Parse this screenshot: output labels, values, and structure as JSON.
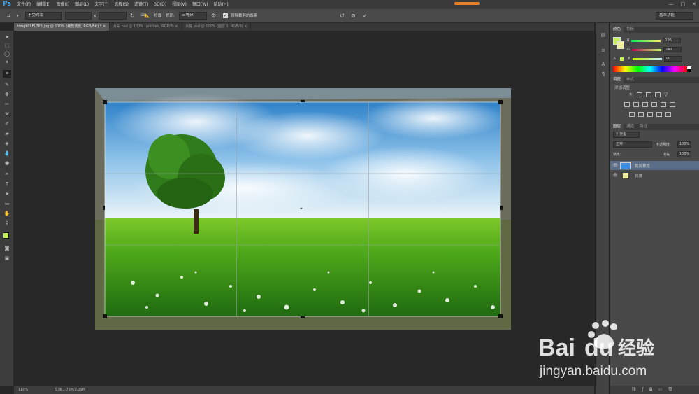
{
  "app": {
    "logo": "Ps"
  },
  "menu": [
    "文件(F)",
    "编辑(E)",
    "图像(I)",
    "图层(L)",
    "文字(Y)",
    "选择(S)",
    "滤镜(T)",
    "3D(D)",
    "视图(V)",
    "窗口(W)",
    "帮助(H)"
  ],
  "window_controls": [
    "—",
    "□",
    "✕"
  ],
  "options_bar": {
    "ratio_preset": "不受约束",
    "width_value": "",
    "times": "x",
    "height_value": "",
    "straighten_label": "拉直",
    "view_label": "视图:",
    "view_value": "三等分",
    "delete_pixels_checked": true,
    "delete_pixels_label": "删除裁剪的像素",
    "workspace": "基本功能"
  },
  "document_tabs": [
    {
      "label": "timgKCLFL765.jpg @ 110% (裁剪预览, RGB/8#) *",
      "close": "×",
      "active": true
    },
    {
      "label": "片头.psd @ 100% (untitled, RGB/8)",
      "close": "×",
      "active": false
    },
    {
      "label": "片尾.psd @ 100% (图层 1, RGB/8)",
      "close": "×",
      "active": false
    }
  ],
  "status": {
    "zoom": "110%",
    "doc": "文档:1.79M/2.39M"
  },
  "color_panel": {
    "tabs": [
      "颜色",
      "色板"
    ],
    "channels": [
      {
        "label": "R",
        "value": "195",
        "gradient": "linear-gradient(to right,#00f08b,#ff f08b)"
      },
      {
        "label": "G",
        "value": "240",
        "gradient": "linear-gradient(to right,#c30090,#c3ff90)"
      },
      {
        "label": "B",
        "value": "90",
        "gradient": "linear-gradient(to right,#c3f000,#c3f0ff)"
      }
    ],
    "fg_color": "#c3f05a",
    "bg_color": "#f0f0a0"
  },
  "adjust_panel": {
    "tabs": [
      "调整",
      "样式"
    ],
    "hint": "添加调整"
  },
  "layers_panel": {
    "tabs": [
      "图层",
      "通道",
      "路径"
    ],
    "filter": "类型",
    "blend_mode": "正常",
    "opacity_label": "不透明度:",
    "opacity_value": "100%",
    "lock_label": "锁定:",
    "fill_label": "填充:",
    "fill_value": "100%",
    "layers": [
      {
        "name": "裁剪预览",
        "selected": true
      },
      {
        "name": "背景",
        "selected": false
      }
    ]
  },
  "watermark": {
    "brand": "Bai",
    "brand2": "du",
    "cn": "经验",
    "url": "jingyan.baidu.com"
  }
}
